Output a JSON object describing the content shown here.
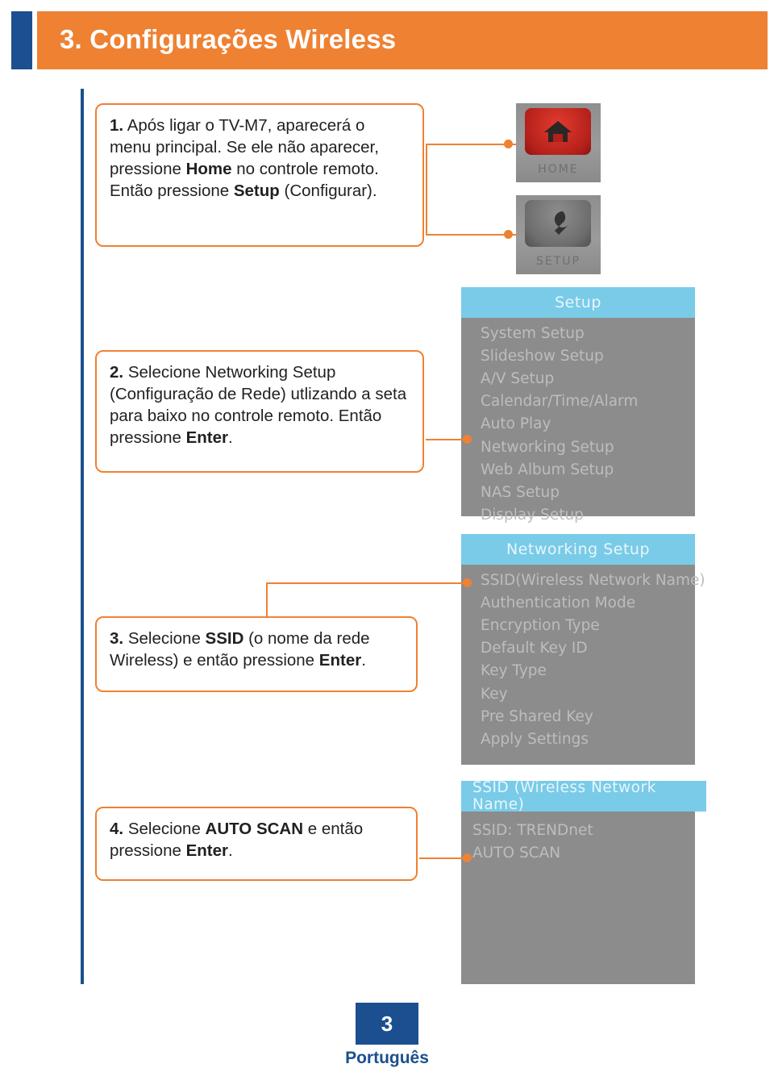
{
  "header": {
    "title": "3. Configurações Wireless"
  },
  "steps": [
    {
      "number": "1.",
      "text_parts": [
        {
          "t": "Após ligar o TV-M7, aparecerá o menu principal. Se ele não aparecer, pressione ",
          "b": false
        },
        {
          "t": "Home",
          "b": true
        },
        {
          "t": " no controle remoto. Então pressione ",
          "b": false
        },
        {
          "t": "Setup",
          "b": true
        },
        {
          "t": " (Configurar).",
          "b": false
        }
      ]
    },
    {
      "number": "2.",
      "text_parts": [
        {
          "t": "Selecione Networking Setup (Configuração de Rede) utlizando a seta para baixo no controle remoto. Então pressione ",
          "b": false
        },
        {
          "t": "Enter",
          "b": true
        },
        {
          "t": ".",
          "b": false
        }
      ]
    },
    {
      "number": "3.",
      "text_parts": [
        {
          "t": "Selecione ",
          "b": false
        },
        {
          "t": "SSID",
          "b": true
        },
        {
          "t": " (o nome da rede Wireless) e então pressione ",
          "b": false
        },
        {
          "t": "Enter",
          "b": true
        },
        {
          "t": ".",
          "b": false
        }
      ]
    },
    {
      "number": "4.",
      "text_parts": [
        {
          "t": "Selecione ",
          "b": false
        },
        {
          "t": "AUTO SCAN",
          "b": true
        },
        {
          "t": " e então pressione ",
          "b": false
        },
        {
          "t": "Enter",
          "b": true
        },
        {
          "t": ".",
          "b": false
        }
      ]
    }
  ],
  "remote": {
    "home_label": "HOME",
    "setup_label": "SETUP",
    "home_icon": "home-icon",
    "setup_icon": "wrench-icon"
  },
  "osd_setup": {
    "title": "Setup",
    "items": [
      "System Setup",
      "Slideshow Setup",
      "A/V Setup",
      "Calendar/Time/Alarm",
      "Auto Play",
      "Networking Setup",
      "Web Album Setup",
      "NAS Setup",
      "Display Setup"
    ]
  },
  "osd_networking": {
    "title": "Networking Setup",
    "items": [
      "SSID(Wireless Network Name)",
      "Authentication Mode",
      "Encryption Type",
      "Default Key ID",
      "Key Type",
      "Key",
      "Pre Shared Key",
      "Apply Settings"
    ]
  },
  "osd_ssid": {
    "title": "SSID (Wireless Network Name)",
    "items": [
      "SSID: TRENDnet",
      "AUTO SCAN"
    ]
  },
  "footer": {
    "page_number": "3",
    "language": "Português"
  },
  "colors": {
    "header_orange": "#ef8132",
    "header_blue": "#1b4f8f",
    "callout_border": "#ef8132",
    "osd_title_bg": "#79cbe8",
    "osd_bg": "#8c8c8c"
  }
}
